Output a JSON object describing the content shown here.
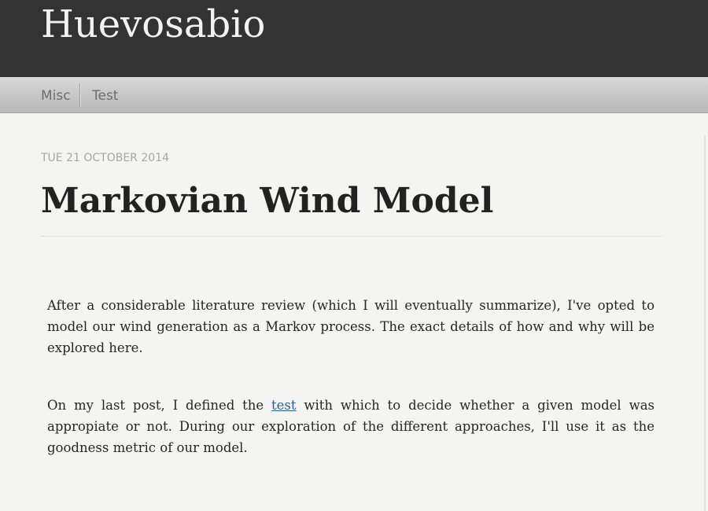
{
  "site": {
    "title": "Huevosabio"
  },
  "nav": {
    "items": [
      {
        "label": "Misc"
      },
      {
        "label": "Test"
      }
    ]
  },
  "post": {
    "date": "TUE 21 OCTOBER 2014",
    "title": "Markovian Wind Model",
    "paragraph1": "After a considerable literature review (which I will eventually summarize), I've opted to model our wind generation as a Markov process. The exact details of how and why will be explored here.",
    "paragraph2_before_link": "On my last post, I defined the ",
    "paragraph2_link": "test",
    "paragraph2_after_link": " with which to decide whether a given model was appropiate or not. During our exploration of the different approaches, I'll use it as the goodness metric of our model."
  },
  "colors": {
    "header_bg": "#333333",
    "nav_bg": "#c4c4c4",
    "page_bg": "#f4f4f3",
    "link": "#2a5f8a"
  }
}
